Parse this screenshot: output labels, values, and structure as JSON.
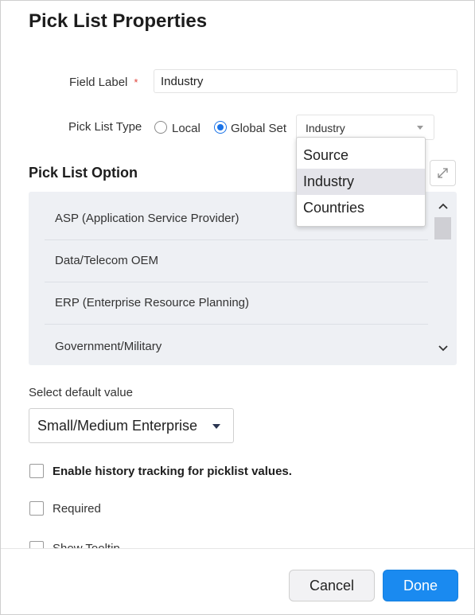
{
  "dialog": {
    "title": "Pick List Properties"
  },
  "field_label": {
    "label": "Field Label",
    "required_mark": "*",
    "value": "Industry"
  },
  "pick_list_type": {
    "label": "Pick List Type",
    "options": [
      {
        "label": "Local",
        "checked": false
      },
      {
        "label": "Global Set",
        "checked": true
      }
    ],
    "global_set_value": "Industry"
  },
  "global_set_dropdown": {
    "items": [
      {
        "label": "Source",
        "selected": false
      },
      {
        "label": "Industry",
        "selected": true
      },
      {
        "label": "Countries",
        "selected": false
      }
    ]
  },
  "pick_list_option": {
    "title": "Pick List Option",
    "items": [
      "ASP (Application Service Provider)",
      "Data/Telecom OEM",
      "ERP (Enterprise Resource Planning)",
      "Government/Military"
    ]
  },
  "default_value": {
    "label": "Select default value",
    "value": "Small/Medium Enterprise"
  },
  "checkboxes": [
    {
      "label": "Enable history tracking for picklist values.",
      "checked": false,
      "bold": true
    },
    {
      "label": "Required",
      "checked": false,
      "bold": false
    },
    {
      "label": "Show Tooltip",
      "checked": false,
      "bold": false
    }
  ],
  "footer": {
    "cancel_label": "Cancel",
    "done_label": "Done"
  },
  "colors": {
    "accent": "#1a8af0",
    "required": "#e0433b",
    "options_bg": "#eef0f4"
  }
}
